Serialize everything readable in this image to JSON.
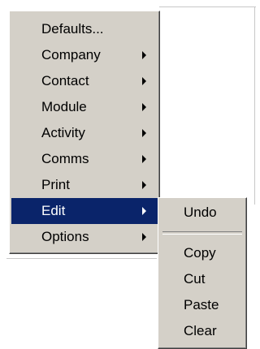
{
  "main_menu": {
    "items": [
      {
        "label": "Defaults...",
        "has_submenu": false
      },
      {
        "label": "Company",
        "has_submenu": true
      },
      {
        "label": "Contact",
        "has_submenu": true
      },
      {
        "label": "Module",
        "has_submenu": true
      },
      {
        "label": "Activity",
        "has_submenu": true
      },
      {
        "label": "Comms",
        "has_submenu": true
      },
      {
        "label": "Print",
        "has_submenu": true
      },
      {
        "label": "Edit",
        "has_submenu": true,
        "selected": true
      },
      {
        "label": "Options",
        "has_submenu": true
      }
    ]
  },
  "edit_submenu": {
    "items": [
      {
        "label": "Undo"
      },
      {
        "label": "Copy"
      },
      {
        "label": "Cut"
      },
      {
        "label": "Paste"
      },
      {
        "label": "Clear"
      }
    ]
  },
  "colors": {
    "menu_background": "#d4d0c8",
    "selection_background": "#0a246a",
    "selection_text": "#ffffff",
    "text": "#000000"
  },
  "icons": {
    "submenu_arrow": "triangle-right-icon"
  }
}
